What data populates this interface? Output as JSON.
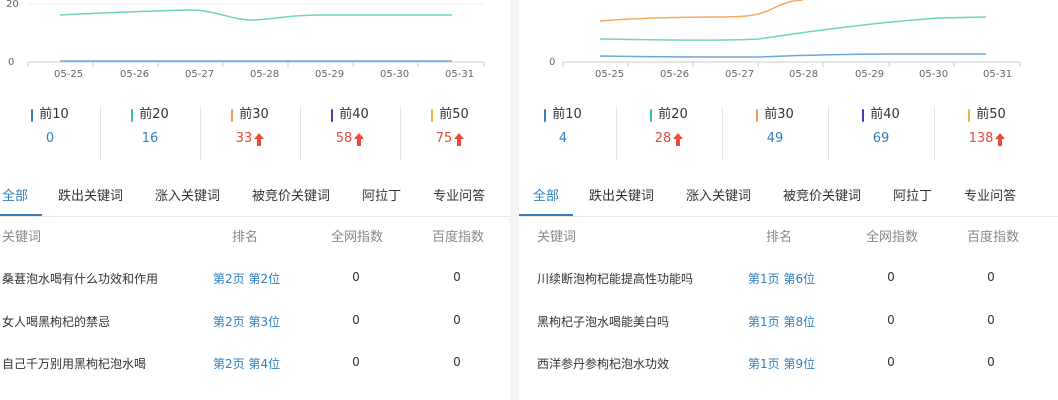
{
  "left": {
    "chart": {
      "y_ticks": [
        "20",
        "0"
      ],
      "x_dates": [
        "05-25",
        "05-26",
        "05-27",
        "05-28",
        "05-29",
        "05-30",
        "05-31"
      ]
    },
    "stats": [
      {
        "label": "前10",
        "value": "0",
        "trend": "none",
        "color": "#2f7fc1"
      },
      {
        "label": "前20",
        "value": "16",
        "trend": "none",
        "color": "#2ec4a6"
      },
      {
        "label": "前30",
        "value": "33",
        "trend": "up",
        "color": "#f39c4a"
      },
      {
        "label": "前40",
        "value": "58",
        "trend": "up",
        "color": "#3b3fbf"
      },
      {
        "label": "前50",
        "value": "75",
        "trend": "up",
        "color": "#f3b233"
      }
    ],
    "tabs": [
      "全部",
      "跌出关键词",
      "涨入关键词",
      "被竞价关键词",
      "阿拉丁",
      "专业问答"
    ],
    "headers": {
      "keyword": "关键词",
      "rank": "排名",
      "all_index": "全网指数",
      "baidu_index": "百度指数"
    },
    "rows": [
      {
        "keyword": "桑葚泡水喝有什么功效和作用",
        "page": "第2页",
        "pos": "第2位",
        "all_index": "0",
        "baidu_index": "0"
      },
      {
        "keyword": "女人喝黑枸杞的禁忌",
        "page": "第2页",
        "pos": "第3位",
        "all_index": "0",
        "baidu_index": "0"
      },
      {
        "keyword": "自己千万别用黑枸杞泡水喝",
        "page": "第2页",
        "pos": "第4位",
        "all_index": "0",
        "baidu_index": "0"
      }
    ]
  },
  "right": {
    "chart": {
      "y_ticks": [
        "0"
      ],
      "x_dates": [
        "05-25",
        "05-26",
        "05-27",
        "05-28",
        "05-29",
        "05-30",
        "05-31"
      ]
    },
    "stats": [
      {
        "label": "前10",
        "value": "4",
        "trend": "none",
        "color": "#2f7fc1"
      },
      {
        "label": "前20",
        "value": "28",
        "trend": "up",
        "color": "#2ec4a6"
      },
      {
        "label": "前30",
        "value": "49",
        "trend": "none",
        "color": "#f39c4a"
      },
      {
        "label": "前40",
        "value": "69",
        "trend": "none",
        "color": "#3b3fbf"
      },
      {
        "label": "前50",
        "value": "138",
        "trend": "up",
        "color": "#f3b233"
      }
    ],
    "tabs": [
      "全部",
      "跌出关键词",
      "涨入关键词",
      "被竞价关键词",
      "阿拉丁",
      "专业问答"
    ],
    "headers": {
      "keyword": "关键词",
      "rank": "排名",
      "all_index": "全网指数",
      "baidu_index": "百度指数"
    },
    "rows": [
      {
        "keyword": "川续断泡枸杞能提高性功能吗",
        "page": "第1页",
        "pos": "第6位",
        "all_index": "0",
        "baidu_index": "0"
      },
      {
        "keyword": "黑枸杞子泡水喝能美白吗",
        "page": "第1页",
        "pos": "第8位",
        "all_index": "0",
        "baidu_index": "0"
      },
      {
        "keyword": "西洋参丹参枸杞泡水功效",
        "page": "第1页",
        "pos": "第9位",
        "all_index": "0",
        "baidu_index": "0"
      }
    ]
  },
  "colors": {
    "accent": "#2f7fc1",
    "up": "#e74c3c",
    "line_top10": "#2f7fc1",
    "line_top20": "#2ec4a6",
    "line_top30": "#f39c4a"
  }
}
